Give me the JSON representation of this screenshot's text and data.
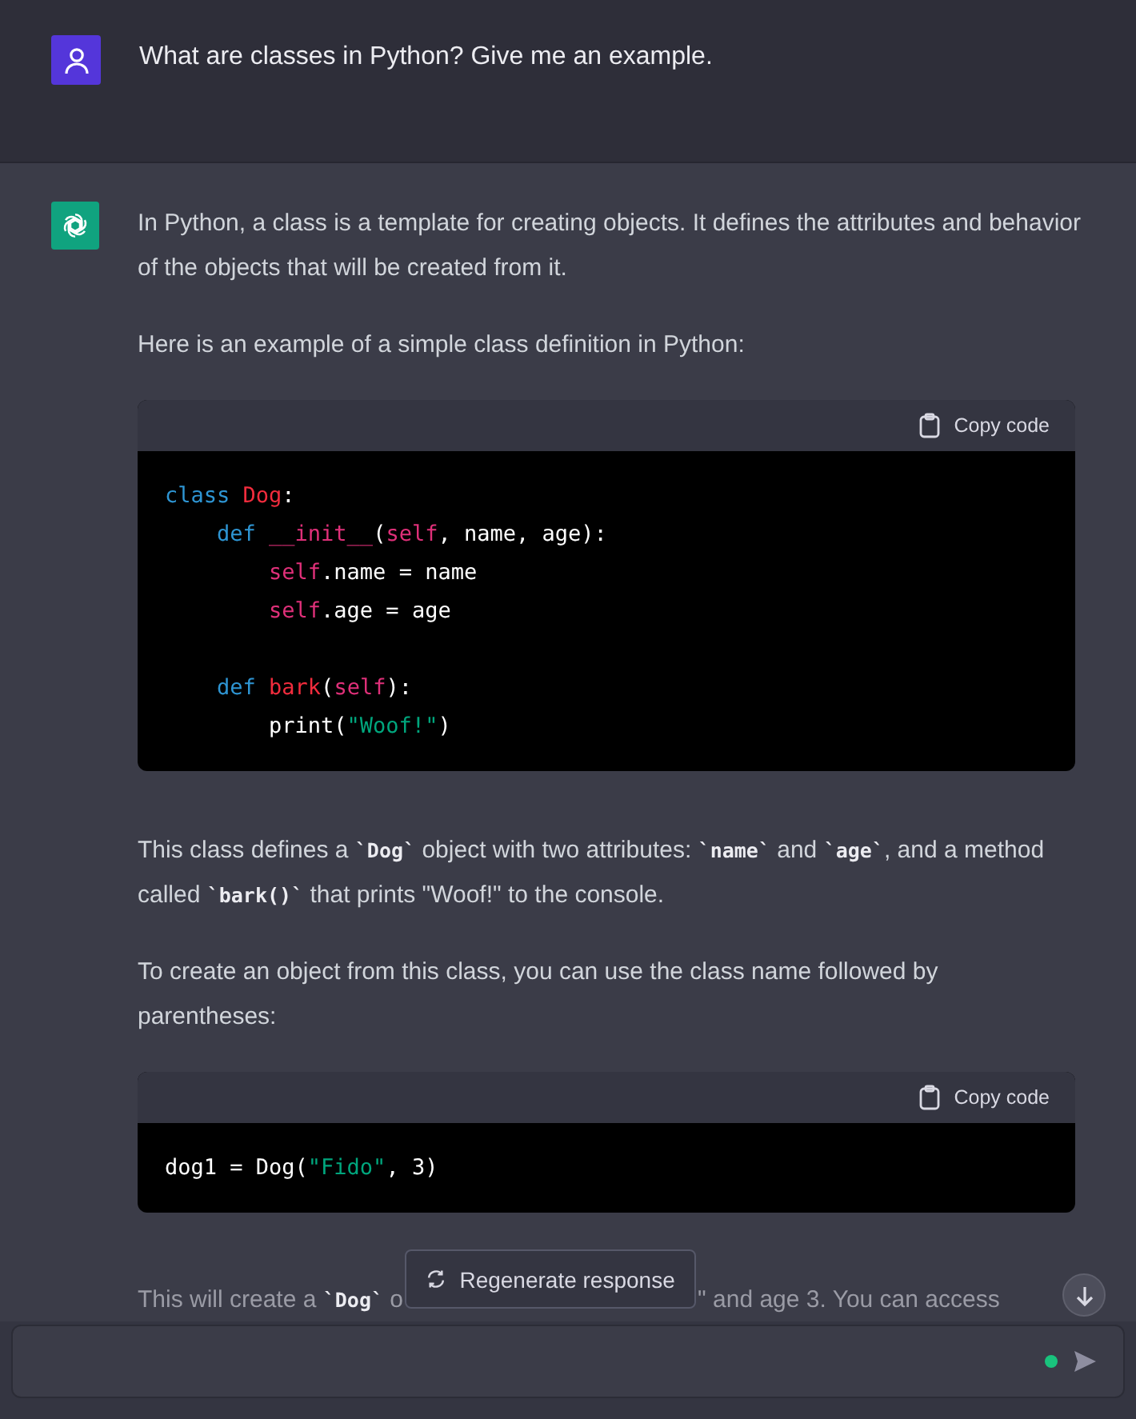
{
  "user_message": {
    "text": "What are classes in Python? Give me an example."
  },
  "assistant_message": {
    "blocks": [
      {
        "kind": "paragraph",
        "segments": [
          {
            "kind": "text",
            "text": "In Python, a class is a template for creating objects. It defines the attributes and behavior of the objects that will be created from it."
          }
        ]
      },
      {
        "kind": "paragraph",
        "segments": [
          {
            "kind": "text",
            "text": "Here is an example of a simple class definition in Python:"
          }
        ]
      },
      {
        "kind": "code",
        "copy_label": "Copy code",
        "lines": [
          {
            "kind": "code",
            "tokens": [
              {
                "kind": "keyword",
                "text": "class "
              },
              {
                "kind": "name",
                "text": "Dog"
              },
              {
                "kind": "plain",
                "text": ":"
              }
            ]
          },
          {
            "kind": "code",
            "tokens": [
              {
                "kind": "keyword",
                "text": "    def "
              },
              {
                "kind": "self",
                "text": "__init__"
              },
              {
                "kind": "plain",
                "text": "("
              },
              {
                "kind": "self",
                "text": "self"
              },
              {
                "kind": "plain",
                "text": ", name, age):"
              }
            ]
          },
          {
            "kind": "code",
            "tokens": [
              {
                "kind": "self",
                "text": "        self"
              },
              {
                "kind": "plain",
                "text": ".name = name"
              }
            ]
          },
          {
            "kind": "code",
            "tokens": [
              {
                "kind": "self",
                "text": "        self"
              },
              {
                "kind": "plain",
                "text": ".age = age"
              }
            ]
          },
          {
            "kind": "blank"
          },
          {
            "kind": "code",
            "tokens": [
              {
                "kind": "keyword",
                "text": "    def "
              },
              {
                "kind": "name",
                "text": "bark"
              },
              {
                "kind": "plain",
                "text": "("
              },
              {
                "kind": "self",
                "text": "self"
              },
              {
                "kind": "plain",
                "text": "):"
              }
            ]
          },
          {
            "kind": "code",
            "tokens": [
              {
                "kind": "plain",
                "text": "        print("
              },
              {
                "kind": "string",
                "text": "\"Woof!\""
              },
              {
                "kind": "plain",
                "text": ")"
              }
            ]
          }
        ]
      },
      {
        "kind": "paragraph",
        "segments": [
          {
            "kind": "text",
            "text": "This class defines a "
          },
          {
            "kind": "code",
            "text": "`Dog`"
          },
          {
            "kind": "text",
            "text": " object with two attributes: "
          },
          {
            "kind": "code",
            "text": "`name`"
          },
          {
            "kind": "text",
            "text": " and "
          },
          {
            "kind": "code",
            "text": "`age`"
          },
          {
            "kind": "text",
            "text": ", and a method called "
          },
          {
            "kind": "code",
            "text": "`bark()`"
          },
          {
            "kind": "text",
            "text": " that prints \"Woof!\" to the console."
          }
        ]
      },
      {
        "kind": "paragraph",
        "segments": [
          {
            "kind": "text",
            "text": "To create an object from this class, you can use the class name followed by parentheses:"
          }
        ]
      },
      {
        "kind": "code",
        "copy_label": "Copy code",
        "lines": [
          {
            "kind": "code",
            "tokens": [
              {
                "kind": "plain",
                "text": "dog1 = Dog("
              },
              {
                "kind": "string",
                "text": "\"Fido\""
              },
              {
                "kind": "plain",
                "text": ", 3)"
              }
            ]
          }
        ]
      }
    ],
    "partial_line": {
      "left": [
        {
          "kind": "text",
          "text": "This will create a "
        },
        {
          "kind": "code",
          "text": "`Dog`"
        },
        {
          "kind": "text",
          "text": " o"
        }
      ],
      "right": [
        {
          "kind": "text",
          "text": "\" and age 3. You can access"
        }
      ]
    }
  },
  "regenerate_button": {
    "label": "Regenerate response"
  },
  "composer": {
    "online": true
  }
}
